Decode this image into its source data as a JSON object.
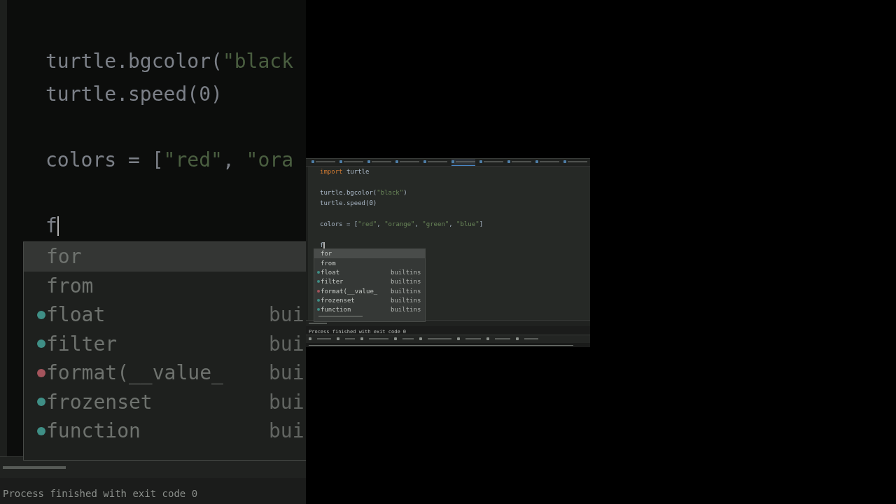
{
  "backdrop": {
    "code_blocks": [
      [
        {
          "tokens": [
            {
              "kind": "plain",
              "text": "turtle.bgcolor("
            },
            {
              "kind": "string",
              "text": "\"black"
            }
          ]
        },
        {
          "tokens": [
            {
              "kind": "plain",
              "text": "turtle.speed(0)"
            }
          ]
        }
      ],
      [
        {
          "tokens": [
            {
              "kind": "plain",
              "text": "colors = ["
            },
            {
              "kind": "string",
              "text": "\"red\""
            },
            {
              "kind": "plain",
              "text": ", "
            },
            {
              "kind": "string",
              "text": "\"ora"
            }
          ]
        }
      ],
      [
        {
          "tokens": [
            {
              "kind": "plain",
              "text": "f"
            }
          ],
          "cursor": true
        }
      ]
    ],
    "completions": [
      {
        "kind": "keyword",
        "label": "for",
        "selected": true
      },
      {
        "kind": "keyword",
        "label": "from",
        "selected": false
      },
      {
        "kind": "function",
        "label": "float",
        "detail": "bui",
        "color": "#3f8f86",
        "selected": false
      },
      {
        "kind": "function",
        "label": "filter",
        "detail": "bui",
        "color": "#3f8f86",
        "selected": false
      },
      {
        "kind": "function",
        "label": "format(__value_",
        "detail": "bui",
        "color": "#a4545c",
        "selected": false
      },
      {
        "kind": "function",
        "label": "frozenset",
        "detail": "bui",
        "color": "#3f8f86",
        "selected": false
      },
      {
        "kind": "function",
        "label": "function",
        "detail": "bui",
        "color": "#3f8f86",
        "selected": false
      }
    ],
    "output": "Process finished with exit code 0"
  },
  "ide": {
    "tabs": [
      {
        "selected": false
      },
      {
        "selected": false
      },
      {
        "selected": false
      },
      {
        "selected": false
      },
      {
        "selected": false
      },
      {
        "selected": true
      },
      {
        "selected": false
      },
      {
        "selected": false
      },
      {
        "selected": false
      },
      {
        "selected": false
      }
    ],
    "code_blocks": [
      [
        {
          "tokens": [
            {
              "kind": "keyword",
              "text": "import"
            },
            {
              "kind": "plain",
              "text": " turtle"
            }
          ]
        }
      ],
      [
        {
          "tokens": [
            {
              "kind": "plain",
              "text": "turtle.bgcolor("
            },
            {
              "kind": "string",
              "text": "\"black\""
            },
            {
              "kind": "plain",
              "text": ")"
            }
          ]
        },
        {
          "tokens": [
            {
              "kind": "plain",
              "text": "turtle.speed(0)"
            }
          ]
        }
      ],
      [
        {
          "tokens": [
            {
              "kind": "plain",
              "text": "colors = ["
            },
            {
              "kind": "string",
              "text": "\"red\""
            },
            {
              "kind": "plain",
              "text": ", "
            },
            {
              "kind": "string",
              "text": "\"orange\""
            },
            {
              "kind": "plain",
              "text": ", "
            },
            {
              "kind": "string",
              "text": "\"green\""
            },
            {
              "kind": "plain",
              "text": ", "
            },
            {
              "kind": "string",
              "text": "\"blue\""
            },
            {
              "kind": "plain",
              "text": "]"
            }
          ]
        }
      ],
      [
        {
          "tokens": [
            {
              "kind": "plain",
              "text": "f"
            }
          ],
          "cursor": true
        }
      ]
    ],
    "completions": [
      {
        "kind": "keyword",
        "label": "for",
        "selected": true
      },
      {
        "kind": "keyword",
        "label": "from",
        "selected": false
      },
      {
        "kind": "function",
        "label": "float",
        "detail": "builtins",
        "color": "#3f8f86",
        "selected": false
      },
      {
        "kind": "function",
        "label": "filter",
        "detail": "builtins",
        "color": "#3f8f86",
        "selected": false
      },
      {
        "kind": "function",
        "label": "format(__value_",
        "detail": "builtins",
        "color": "#a4545c",
        "selected": false
      },
      {
        "kind": "function",
        "label": "frozenset",
        "detail": "builtins",
        "color": "#3f8f86",
        "selected": false
      },
      {
        "kind": "function",
        "label": "function",
        "detail": "builtins",
        "color": "#3f8f86",
        "selected": false
      }
    ],
    "output": "Process finished with exit code 0"
  }
}
